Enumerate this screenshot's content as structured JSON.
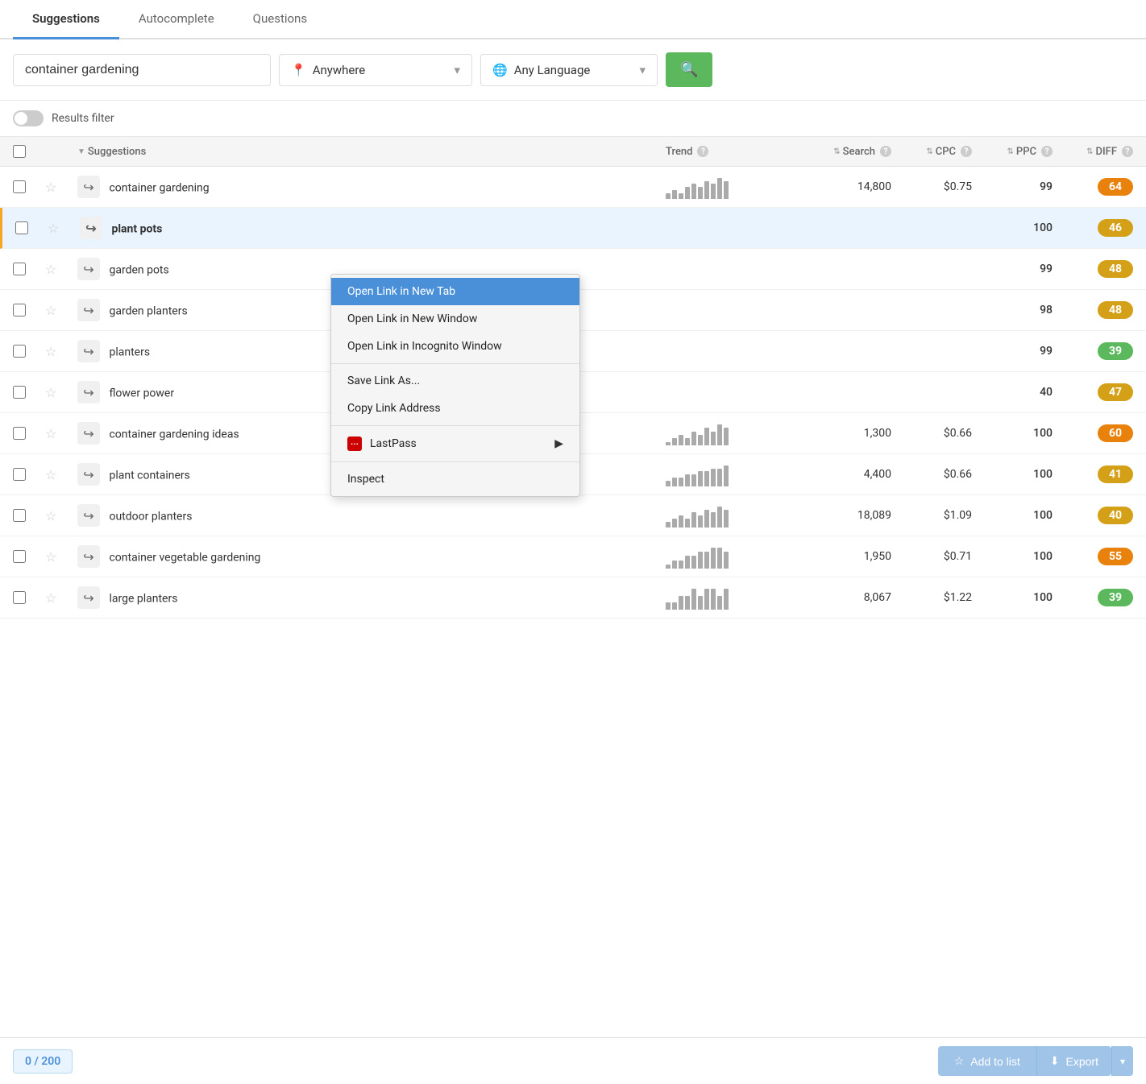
{
  "tabs": [
    {
      "label": "Suggestions",
      "active": true
    },
    {
      "label": "Autocomplete",
      "active": false
    },
    {
      "label": "Questions",
      "active": false
    }
  ],
  "search": {
    "keyword": "container gardening",
    "location": "Anywhere",
    "language": "Any Language",
    "button_icon": "🔍"
  },
  "filter": {
    "label": "Results filter"
  },
  "table": {
    "headers": [
      "",
      "",
      "Suggestions",
      "Trend",
      "Search",
      "CPC",
      "PPC",
      "DIFF"
    ],
    "rows": [
      {
        "keyword": "container gardening",
        "trend": [
          2,
          3,
          2,
          4,
          5,
          4,
          6,
          5,
          7,
          6
        ],
        "search": "14,800",
        "cpc": "$0.75",
        "ppc": "99",
        "diff": "64",
        "diff_color": "orange",
        "bold": false,
        "highlighted": false
      },
      {
        "keyword": "plant pots",
        "trend": [],
        "search": "",
        "cpc": "",
        "ppc": "100",
        "diff": "46",
        "diff_color": "yellow",
        "bold": true,
        "highlighted": true
      },
      {
        "keyword": "garden pots",
        "trend": [],
        "search": "",
        "cpc": "",
        "ppc": "99",
        "diff": "48",
        "diff_color": "yellow",
        "bold": false,
        "highlighted": false
      },
      {
        "keyword": "garden planters",
        "trend": [],
        "search": "",
        "cpc": "",
        "ppc": "98",
        "diff": "48",
        "diff_color": "yellow",
        "bold": false,
        "highlighted": false
      },
      {
        "keyword": "planters",
        "trend": [],
        "search": "",
        "cpc": "",
        "ppc": "99",
        "diff": "39",
        "diff_color": "green",
        "bold": false,
        "highlighted": false
      },
      {
        "keyword": "flower power",
        "trend": [],
        "search": "",
        "cpc": "",
        "ppc": "40",
        "diff": "47",
        "diff_color": "yellow",
        "bold": false,
        "highlighted": false
      },
      {
        "keyword": "container gardening ideas",
        "trend": [
          1,
          2,
          3,
          2,
          4,
          3,
          5,
          4,
          6,
          5
        ],
        "search": "1,300",
        "cpc": "$0.66",
        "ppc": "100",
        "diff": "60",
        "diff_color": "orange",
        "bold": false,
        "highlighted": false
      },
      {
        "keyword": "plant containers",
        "trend": [
          2,
          3,
          3,
          4,
          4,
          5,
          5,
          6,
          6,
          7
        ],
        "search": "4,400",
        "cpc": "$0.66",
        "ppc": "100",
        "diff": "41",
        "diff_color": "yellow",
        "bold": false,
        "highlighted": false
      },
      {
        "keyword": "outdoor planters",
        "trend": [
          2,
          3,
          4,
          3,
          5,
          4,
          6,
          5,
          7,
          6
        ],
        "search": "18,089",
        "cpc": "$1.09",
        "ppc": "100",
        "diff": "40",
        "diff_color": "yellow",
        "bold": false,
        "highlighted": false
      },
      {
        "keyword": "container vegetable gardening",
        "trend": [
          1,
          2,
          2,
          3,
          3,
          4,
          4,
          5,
          5,
          4
        ],
        "search": "1,950",
        "cpc": "$0.71",
        "ppc": "100",
        "diff": "55",
        "diff_color": "orange",
        "bold": false,
        "highlighted": false
      },
      {
        "keyword": "large planters",
        "trend": [
          1,
          1,
          2,
          2,
          3,
          2,
          3,
          3,
          2,
          3
        ],
        "search": "8,067",
        "cpc": "$1.22",
        "ppc": "100",
        "diff": "39",
        "diff_color": "green",
        "bold": false,
        "highlighted": false
      }
    ]
  },
  "context_menu": {
    "items": [
      {
        "label": "Open Link in New Tab",
        "highlighted": true
      },
      {
        "label": "Open Link in New Window",
        "highlighted": false
      },
      {
        "label": "Open Link in Incognito Window",
        "highlighted": false
      },
      {
        "divider": true
      },
      {
        "label": "Save Link As...",
        "highlighted": false
      },
      {
        "label": "Copy Link Address",
        "highlighted": false
      },
      {
        "divider": true
      },
      {
        "label": "LastPass",
        "lastpass": true,
        "has_submenu": true
      },
      {
        "divider": true
      },
      {
        "label": "Inspect",
        "highlighted": false
      }
    ]
  },
  "footer": {
    "count": "0 / 200",
    "add_to_list": "Add to list",
    "export": "Export"
  }
}
